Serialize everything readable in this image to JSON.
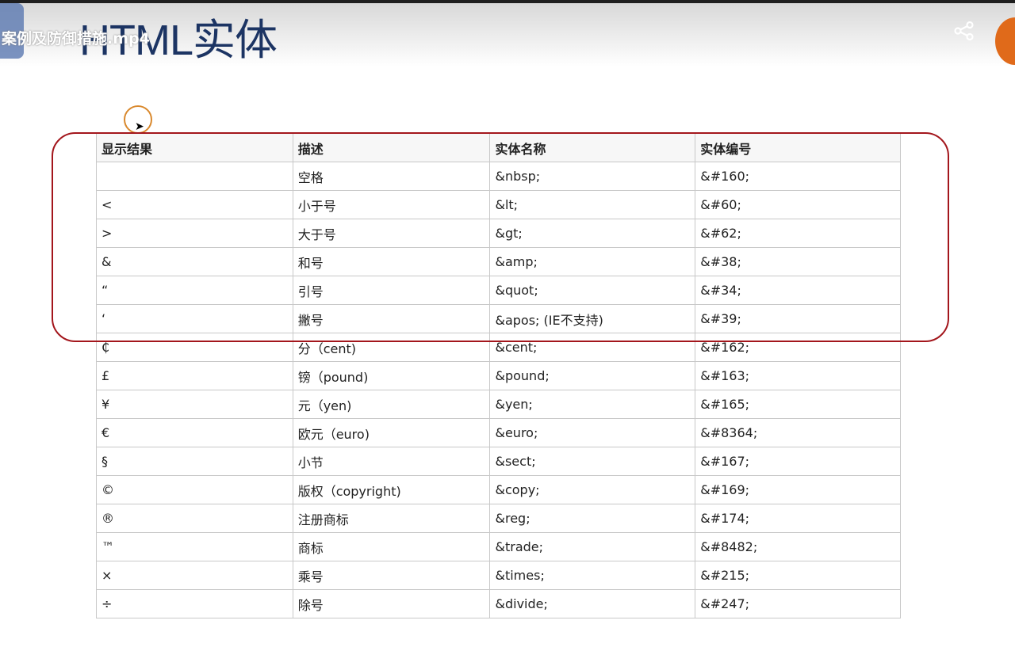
{
  "video": {
    "filename": "案例及防御措施.mp4",
    "slide_title": "HTML实体"
  },
  "table": {
    "headers": [
      "显示结果",
      "描述",
      "实体名称",
      "实体编号"
    ],
    "rows": [
      [
        "",
        "空格",
        "&nbsp;",
        "&#160;"
      ],
      [
        "<",
        "小于号",
        "&lt;",
        "&#60;"
      ],
      [
        ">",
        "大于号",
        "&gt;",
        "&#62;"
      ],
      [
        "&",
        "和号",
        "&amp;",
        "&#38;"
      ],
      [
        "“",
        "引号",
        "&quot;",
        "&#34;"
      ],
      [
        "‘",
        "撇号",
        "&apos; (IE不支持)",
        "&#39;"
      ],
      [
        "₵",
        "分（cent)",
        "&cent;",
        "&#162;"
      ],
      [
        "£",
        "镑（pound)",
        "&pound;",
        "&#163;"
      ],
      [
        "¥",
        "元（yen)",
        "&yen;",
        "&#165;"
      ],
      [
        "€",
        "欧元（euro)",
        "&euro;",
        "&#8364;"
      ],
      [
        "§",
        "小节",
        "&sect;",
        "&#167;"
      ],
      [
        "©",
        "版权（copyright)",
        "&copy;",
        "&#169;"
      ],
      [
        "®",
        "注册商标",
        "&reg;",
        "&#174;"
      ],
      [
        "™",
        "商标",
        "&trade;",
        "&#8482;"
      ],
      [
        "×",
        "乘号",
        "&times;",
        "&#215;"
      ],
      [
        "÷",
        "除号",
        "&divide;",
        "&#247;"
      ]
    ]
  },
  "colors": {
    "highlight": "#a3161c",
    "title": "#1c3463"
  }
}
